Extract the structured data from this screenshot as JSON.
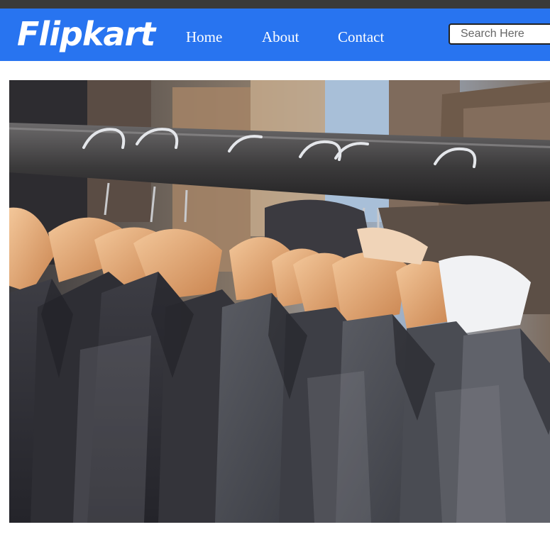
{
  "header": {
    "logo_text": "Flipkart",
    "nav": {
      "home": "Home",
      "about": "About",
      "contact": "Contact"
    },
    "search": {
      "placeholder": "Search Here"
    }
  },
  "hero": {
    "image_description": ""
  },
  "colors": {
    "navbar": "#2874f0",
    "top_strip": "#3a3a3a"
  }
}
